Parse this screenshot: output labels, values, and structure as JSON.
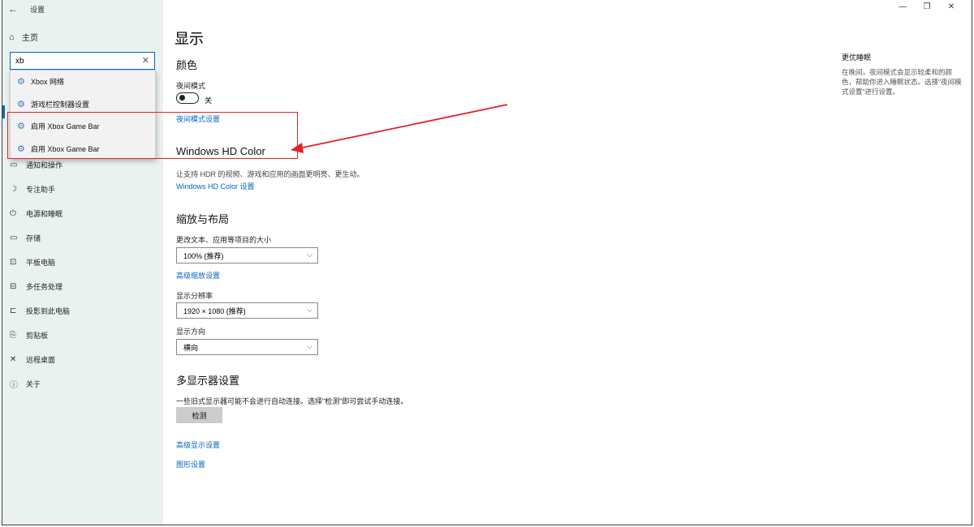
{
  "window": {
    "title": "设置",
    "back_icon": "←",
    "controls": {
      "minimize": "—",
      "maximize": "❐",
      "close": "✕"
    }
  },
  "sidebar": {
    "home_label": "主页",
    "search": {
      "value": "xb",
      "clear_icon": "✕"
    },
    "suggestions": [
      {
        "label": "Xbox 网络",
        "icon": "gear-icon"
      },
      {
        "label": "游戏栏控制器设置",
        "icon": "gear-icon"
      },
      {
        "label": "启用 Xbox Game Bar",
        "icon": "gear-icon"
      },
      {
        "label": "启用 Xbox Game Bar",
        "icon": "gear-icon"
      }
    ],
    "items": [
      {
        "label": "通知和操作",
        "icon": "▭"
      },
      {
        "label": "专注助手",
        "icon": "☽"
      },
      {
        "label": "电源和睡眠",
        "icon": "⏻"
      },
      {
        "label": "存储",
        "icon": "▭"
      },
      {
        "label": "平板电脑",
        "icon": "⊡"
      },
      {
        "label": "多任务处理",
        "icon": "⊟"
      },
      {
        "label": "投影到此电脑",
        "icon": "⊏"
      },
      {
        "label": "剪贴板",
        "icon": "⎘"
      },
      {
        "label": "远程桌面",
        "icon": "✕"
      },
      {
        "label": "关于",
        "icon": "ⓘ"
      }
    ]
  },
  "main": {
    "title": "显示",
    "color_section": {
      "heading": "颜色",
      "night_mode_label": "夜间模式",
      "night_mode_state": "关",
      "night_mode_link": "夜间模式设置"
    },
    "hdr_section": {
      "heading": "Windows HD Color",
      "desc": "让支持 HDR 的视频、游戏和应用的画面更明亮、更生动。",
      "link": "Windows HD Color 设置"
    },
    "scale_section": {
      "heading": "缩放与布局",
      "scale_label": "更改文本、应用等项目的大小",
      "scale_value": "100% (推荐)",
      "scale_link": "高级缩放设置",
      "resolution_label": "显示分辨率",
      "resolution_value": "1920 × 1080 (推荐)",
      "orientation_label": "显示方向",
      "orientation_value": "横向"
    },
    "multi_section": {
      "heading": "多显示器设置",
      "desc": "一些旧式显示器可能不会进行自动连接。选择\"检测\"即可尝试手动连接。",
      "detect_label": "检测",
      "advanced_link": "高级显示设置",
      "graphics_link": "图形设置"
    }
  },
  "side_tip": {
    "title": "更优睡眠",
    "text": "在晚间，夜间模式会显示较柔和的颜色，帮助你进入睡眠状态。选择\"夜间模式设置\"进行设置。"
  },
  "colors": {
    "accent": "#0067c0",
    "annotation": "#e0232a",
    "sidebar_bg": "#eaf2f0"
  }
}
